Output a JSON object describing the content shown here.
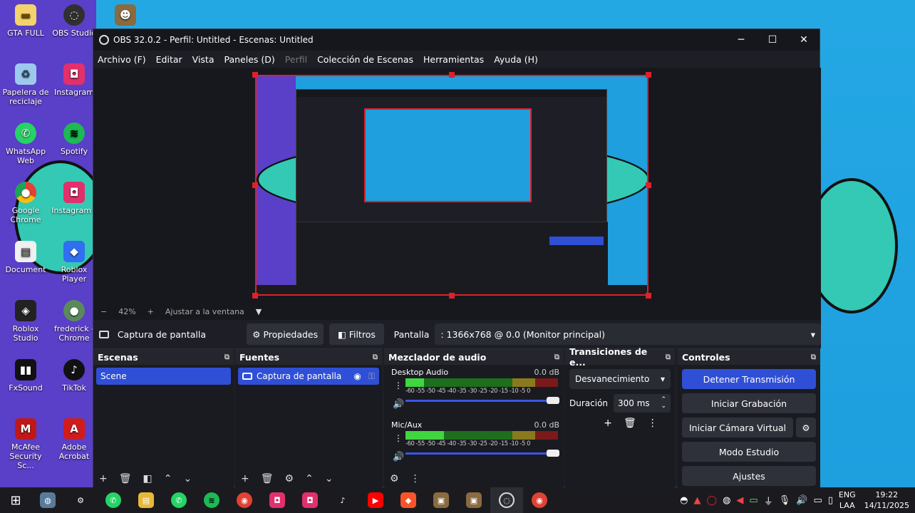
{
  "desktop": {
    "icons": [
      {
        "label": "GTA FULL",
        "icon": "folder-icon",
        "color": "#f3d36b"
      },
      {
        "label": "OBS Studio",
        "icon": "obs-icon",
        "color": "#303030"
      },
      {
        "label": "",
        "icon": "photo-shortcut-icon",
        "color": "#8a6a40"
      },
      {
        "label": "Papelera de reciclaje",
        "icon": "recycle-bin-icon",
        "color": "#9ec9ef"
      },
      {
        "label": "Instagram",
        "icon": "instagram-icon",
        "color": "#e1306c"
      },
      {
        "label": "WhatsApp Web",
        "icon": "whatsapp-icon",
        "color": "#25d366"
      },
      {
        "label": "Spotify",
        "icon": "spotify-icon",
        "color": "#1db954"
      },
      {
        "label": "Google Chrome",
        "icon": "chrome-icon",
        "color": "#e34133"
      },
      {
        "label": "Instagram (",
        "icon": "instagram-icon",
        "color": "#e1306c"
      },
      {
        "label": "Document",
        "icon": "document-icon",
        "color": "#f0f0f0"
      },
      {
        "label": "Roblox Player",
        "icon": "roblox-icon",
        "color": "#2f6ff0"
      },
      {
        "label": "Roblox Studio",
        "icon": "roblox-studio-icon",
        "color": "#222"
      },
      {
        "label": "frederick - Chrome",
        "icon": "chrome-profile-icon",
        "color": "#5a8a5a"
      },
      {
        "label": "FxSound",
        "icon": "fxsound-icon",
        "color": "#111"
      },
      {
        "label": "TikTok",
        "icon": "tiktok-icon",
        "color": "#111"
      },
      {
        "label": "McAfee Security Sc...",
        "icon": "mcafee-icon",
        "color": "#c01818"
      },
      {
        "label": "Adobe Acrobat",
        "icon": "acrobat-icon",
        "color": "#d01c1c"
      }
    ]
  },
  "window": {
    "title": "OBS 32.0.2 - Perfil: Untitled - Escenas: Untitled",
    "minimize": "─",
    "maximize": "☐",
    "close": "✕"
  },
  "menu": [
    "Archivo (F)",
    "Editar",
    "Vista",
    "Paneles (D)",
    "Perfil",
    "Colección de Escenas",
    "Herramientas",
    "Ayuda (H)"
  ],
  "zoom": {
    "minus": "−",
    "value": "42%",
    "plus": "+",
    "fit": "Ajustar a la ventana",
    "caret": "▼"
  },
  "source_bar": {
    "source": "Captura de pantalla",
    "properties": "Propiedades",
    "filters": "Filtros",
    "display_label": "Pantalla",
    "display_value": ": 1366x768 @ 0.0 (Monitor principal)"
  },
  "scenes": {
    "title": "Escenas",
    "items": [
      "Scene"
    ]
  },
  "sources": {
    "title": "Fuentes",
    "items": [
      "Captura de pantalla"
    ]
  },
  "mixer": {
    "title": "Mezclador de audio",
    "ticks": "-60 -55 -50 -45 -40 -35 -30 -25 -20 -15 -10 -5 0",
    "channels": [
      {
        "name": "Desktop Audio",
        "db": "0.0 dB",
        "level": 0.12
      },
      {
        "name": "Mic/Aux",
        "db": "0.0 dB",
        "level": 0.25
      }
    ]
  },
  "transitions": {
    "title": "Transiciones de e...",
    "selected": "Desvanecimiento",
    "duration_label": "Duración",
    "duration_value": "300 ms"
  },
  "controls": {
    "title": "Controles",
    "stop_stream": "Detener Transmisión",
    "start_recording": "Iniciar Grabación",
    "virtual_camera": "Iniciar Cámara Virtual",
    "studio_mode": "Modo Estudio",
    "settings": "Ajustes",
    "accent": "#2f4fd6"
  },
  "taskbar": {
    "items": [
      {
        "icon": "windows-start-icon",
        "glyph": "⊞"
      },
      {
        "icon": "copilot-icon",
        "glyph": "◍"
      },
      {
        "icon": "settings-icon",
        "glyph": "⚙"
      },
      {
        "icon": "whatsapp-icon",
        "glyph": "✆"
      },
      {
        "icon": "file-explorer-icon",
        "glyph": "▤"
      },
      {
        "icon": "whatsapp-icon",
        "glyph": "✆"
      },
      {
        "icon": "spotify-icon",
        "glyph": "≋"
      },
      {
        "icon": "chrome-icon",
        "glyph": "◉"
      },
      {
        "icon": "instagram-icon",
        "glyph": "◘"
      },
      {
        "icon": "instagram-icon",
        "glyph": "◘"
      },
      {
        "icon": "tiktok-icon",
        "glyph": "♪"
      },
      {
        "icon": "youtube-icon",
        "glyph": "▶"
      },
      {
        "icon": "brave-icon",
        "glyph": "◆"
      },
      {
        "icon": "photo-icon",
        "glyph": "▣"
      },
      {
        "icon": "photo-icon",
        "glyph": "▣"
      },
      {
        "icon": "obs-icon",
        "glyph": "◌"
      },
      {
        "icon": "chrome-icon",
        "glyph": "◉"
      }
    ],
    "lang_top": "ENG",
    "lang_bottom": "LAA",
    "time": "19:22",
    "date": "14/11/2025"
  }
}
